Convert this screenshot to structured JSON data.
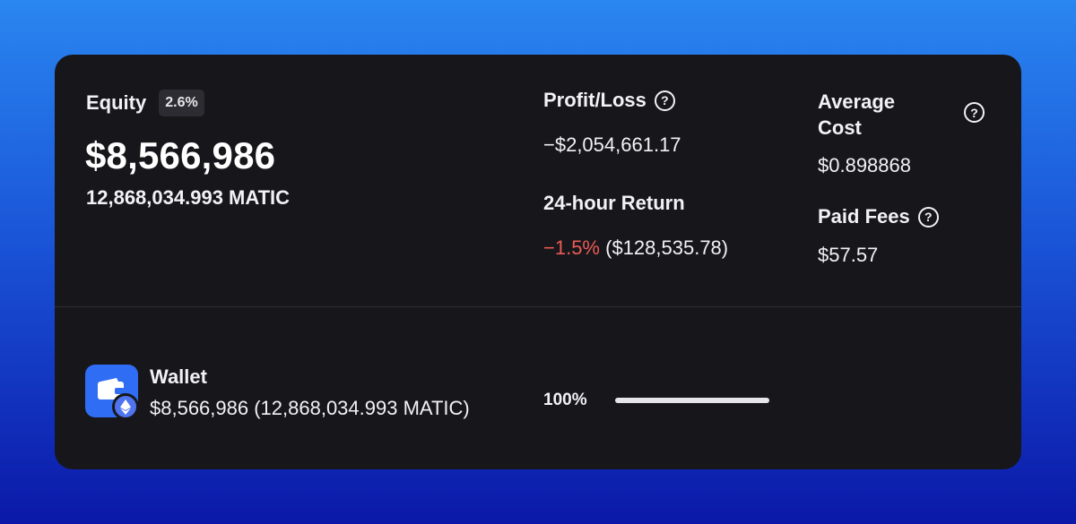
{
  "equity": {
    "label": "Equity",
    "change_badge": "2.6%",
    "value": "$8,566,986",
    "matic_amount": "12,868,034.993 MATIC"
  },
  "profit_loss": {
    "label": "Profit/Loss",
    "value": "−$2,054,661.17",
    "help_icon": "question-circle-icon"
  },
  "return_24h": {
    "label": "24-hour Return",
    "percent": "−1.5%",
    "amount": "($128,535.78)",
    "percent_color": "#ec5a55"
  },
  "average_cost": {
    "label": "Average Cost",
    "value": "$0.898868",
    "help_icon": "question-circle-icon"
  },
  "paid_fees": {
    "label": "Paid Fees",
    "value": "$57.57",
    "help_icon": "question-circle-icon"
  },
  "wallet": {
    "title": "Wallet",
    "amount": "$8,566,986 (12,868,034.993 MATIC)",
    "allocation_label": "100%",
    "allocation_fraction": 1.0,
    "icon": "wallet-icon",
    "network_icon": "ethereum-icon",
    "icon_color": "#2f6df4"
  },
  "colors": {
    "card_background": "#17171b",
    "negative": "#ec5a55",
    "text": "#f2f2f4"
  }
}
